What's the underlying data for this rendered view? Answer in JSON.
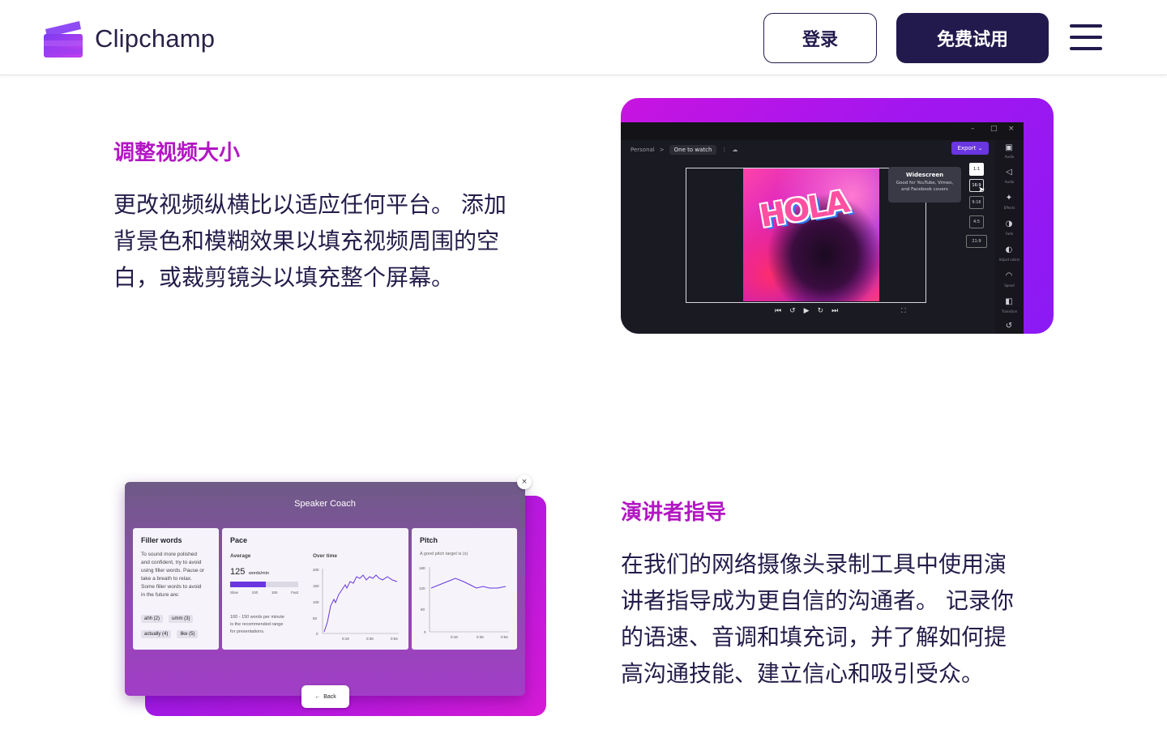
{
  "header": {
    "brand": "Clipchamp",
    "login_label": "登录",
    "trial_label": "免费试用",
    "menu_icon": "hamburger-menu-icon",
    "colors": {
      "primary": "#221a4d",
      "logo_top": "#8b3ff0",
      "logo_bottom": "#c83ff0"
    }
  },
  "section_resize": {
    "title": "调整视频大小",
    "lines": [
      "更改视频纵横比以适应任何平台。 添加",
      "背景色和模糊效果以填充视频周围的空",
      "白，或裁剪镜头以填充整个屏幕。"
    ]
  },
  "editor_mock": {
    "crumb_root": "Personal",
    "crumb_sep": ">",
    "crumb_project": "One to watch",
    "export_label": "Export",
    "sticker_text": "HOLA",
    "tooltip_title": "Widescreen",
    "tooltip_body_1": "Good for YouTube, Vimeo,",
    "tooltip_body_2": "and Facebook covers",
    "ratios": [
      "1:1",
      "16:9",
      "9:16",
      "4:5",
      "21:9"
    ],
    "rail": [
      {
        "icon": "captions-icon",
        "label": "Audio"
      },
      {
        "icon": "speaker-icon",
        "label": "Audio"
      },
      {
        "icon": "wand-icon",
        "label": "Effects"
      },
      {
        "icon": "fade-icon",
        "label": "Fade"
      },
      {
        "icon": "contrast-icon",
        "label": "Adjust colors"
      },
      {
        "icon": "speed-icon",
        "label": "Speed"
      },
      {
        "icon": "transition-icon",
        "label": "Transition"
      }
    ]
  },
  "section_coach": {
    "title": "演讲者指导",
    "lines": [
      "在我们的网络摄像头录制工具中使用演",
      "讲者指导成为更自信的沟通者。 记录你",
      "的语速、音调和填充词，并了解如何提",
      "高沟通技能、建立信心和吸引受众。"
    ]
  },
  "coach_mock": {
    "title": "Speaker Coach",
    "filler": {
      "heading": "Filler words",
      "text_lines": [
        "To sound more polished",
        "and confident, try to avoid",
        "using filler words. Pause or",
        "take a breath to relax.",
        "Some filler words to avoid",
        "in the future are:"
      ],
      "tags": [
        "ahh (2)",
        "umm (3)",
        "actually (4)",
        "like (5)"
      ]
    },
    "pace": {
      "heading": "Pace",
      "average_label": "Average",
      "value": "125",
      "unit": "words/min",
      "progress": 0.52,
      "scale": [
        "Slow",
        "100",
        "150",
        "Fast"
      ],
      "note_lines": [
        "100 - 150 words per minute",
        "is the recommended range",
        "for presentations."
      ],
      "over_time_label": "Over time",
      "y_ticks": [
        "200",
        "150",
        "100",
        "50",
        "0"
      ],
      "x_ticks": [
        "0:18",
        "0:36",
        "0:54"
      ]
    },
    "pitch": {
      "heading": "Pitch",
      "subtitle": "A good pitch target is (x)",
      "y_ticks": [
        "180",
        "120",
        "60",
        "0"
      ],
      "x_ticks": [
        "0:18",
        "0:36",
        "0:54"
      ]
    },
    "back_label": "Back",
    "close_glyph": "×"
  }
}
